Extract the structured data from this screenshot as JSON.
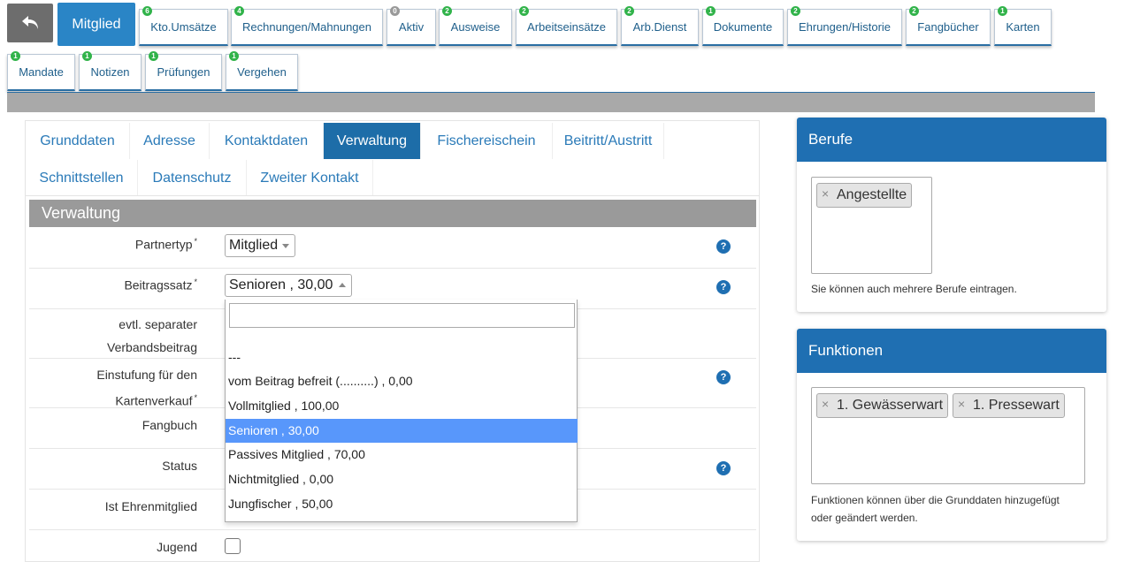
{
  "top_tabs": {
    "active": "Mitglied",
    "items": [
      {
        "label": "Kto.Umsätze",
        "badge": "6",
        "badge_color": "green"
      },
      {
        "label": "Rechnungen/Mahnungen",
        "badge": "4",
        "badge_color": "green"
      },
      {
        "label": "Aktiv",
        "badge": "0",
        "badge_color": "grey"
      },
      {
        "label": "Ausweise",
        "badge": "2",
        "badge_color": "green"
      },
      {
        "label": "Arbeitseinsätze",
        "badge": "2",
        "badge_color": "green"
      },
      {
        "label": "Arb.Dienst",
        "badge": "2",
        "badge_color": "green"
      },
      {
        "label": "Dokumente",
        "badge": "1",
        "badge_color": "green"
      },
      {
        "label": "Ehrungen/Historie",
        "badge": "2",
        "badge_color": "green"
      },
      {
        "label": "Fangbücher",
        "badge": "2",
        "badge_color": "green"
      },
      {
        "label": "Karten",
        "badge": "1",
        "badge_color": "green"
      },
      {
        "label": "Mandate",
        "badge": "1",
        "badge_color": "green"
      },
      {
        "label": "Notizen",
        "badge": "1",
        "badge_color": "green"
      },
      {
        "label": "Prüfungen",
        "badge": "1",
        "badge_color": "green"
      },
      {
        "label": "Vergehen",
        "badge": "1",
        "badge_color": "green"
      }
    ]
  },
  "sub_tabs": [
    "Grunddaten",
    "Adresse",
    "Kontaktdaten",
    "Verwaltung",
    "Fischereischein",
    "Beitritt/Austritt",
    "Schnittstellen",
    "Datenschutz",
    "Zweiter Kontakt"
  ],
  "sub_tab_active": "Verwaltung",
  "section_title": "Verwaltung",
  "form": {
    "partnertyp_label": "Partnertyp",
    "partnertyp_value": "Mitglied",
    "beitragssatz_label": "Beitragssatz",
    "beitragssatz_value": "Senioren , 30,00",
    "verbandsbeitrag_label_1": "evtl. separater",
    "verbandsbeitrag_label_2": "Verbandsbeitrag",
    "einstufung_label_1": "Einstufung für den",
    "einstufung_label_2": "Kartenverkauf",
    "fangbuch_label": "Fangbuch",
    "status_label": "Status",
    "ehrenmitglied_label": "Ist Ehrenmitglied",
    "jugend_label": "Jugend",
    "required_mark": "*",
    "help_glyph": "?"
  },
  "dropdown": {
    "search_value": "",
    "options": [
      "---",
      "vom Beitrag befreit (..........) , 0,00",
      "Vollmitglied , 100,00",
      "Senioren , 30,00",
      "Passives Mitglied , 70,00",
      "Nichtmitglied , 0,00",
      "Jungfischer , 50,00"
    ],
    "selected_index": 3
  },
  "berufe": {
    "title": "Berufe",
    "tags": [
      "Angestellte"
    ],
    "note": "Sie können auch mehrere Berufe eintragen."
  },
  "funktionen": {
    "title": "Funktionen",
    "tags": [
      "1. Gewässerwart",
      "1. Pressewart"
    ],
    "note_1": "Funktionen können über die Grunddaten hinzugefügt",
    "note_2": "oder geändert werden."
  },
  "colors": {
    "primary": "#1f6fb2",
    "badge_green": "#31b34a",
    "badge_grey": "#999999",
    "selected_option": "#5897fb"
  },
  "icons": {
    "back": "undo-arrow-icon",
    "help": "question-circle-icon",
    "tag_remove": "close-icon"
  }
}
